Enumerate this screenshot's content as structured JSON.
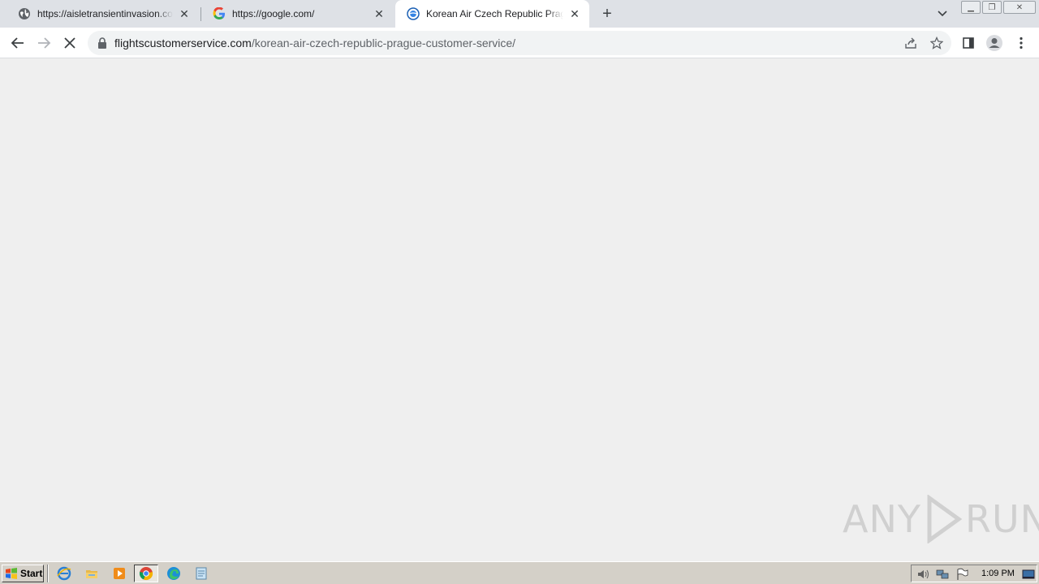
{
  "browser": {
    "tabs": [
      {
        "title": "https://aisletransientinvasion.com/d",
        "favicon": "globe-icon",
        "active": false
      },
      {
        "title": "https://google.com/",
        "favicon": "google-icon",
        "active": false
      },
      {
        "title": "Korean Air Czech Republic Prague C",
        "favicon": "site-logo-icon",
        "active": true
      }
    ],
    "new_tab_symbol": "+",
    "close_symbol": "✕",
    "window_controls": {
      "minimize": "▁",
      "restore": "❐",
      "close": "✕"
    },
    "omnibox": {
      "url_host": "flightscustomerservice.com",
      "url_path": "/korean-air-czech-republic-prague-customer-service/"
    }
  },
  "watermark": {
    "left": "ANY",
    "right": "RUN"
  },
  "taskbar": {
    "start_label": "Start",
    "clock": "1:09 PM",
    "apps": [
      "ie-icon",
      "explorer-icon",
      "media-player-icon",
      "chrome-icon",
      "edge-icon",
      "notepad-icon"
    ]
  },
  "colors": {
    "accent": "#1a73e8",
    "tab_strip": "#dee1e6",
    "page_bg": "#efefef",
    "taskbar": "#d4d0c8"
  }
}
